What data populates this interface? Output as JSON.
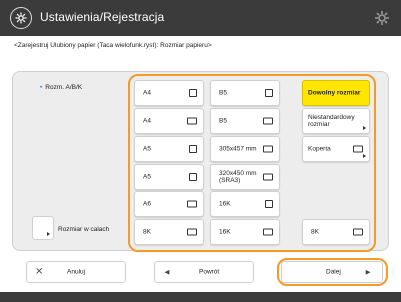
{
  "header": {
    "title": "Ustawienia/Rejestracja",
    "title_icon": "settings-register-icon",
    "right_icon": "gear-icon"
  },
  "breadcrumb": "<Zarejestruj Ulubiony papier (Taca wielofunk.ryst): Rozmiar papieru>",
  "group_label": "Rozm. A/B/K",
  "sizes": [
    {
      "label": "A4",
      "icon": "portrait-page-icon"
    },
    {
      "label": "B5",
      "icon": "portrait-page-icon"
    },
    {
      "label": "A4",
      "icon": "landscape-page-icon"
    },
    {
      "label": "B5",
      "icon": "landscape-page-icon"
    },
    {
      "label": "A5",
      "icon": "portrait-page-icon"
    },
    {
      "label": "305x457 mm",
      "icon": "landscape-page-icon"
    },
    {
      "label": "A5",
      "icon": "portrait-page-icon"
    },
    {
      "label": "320x450 mm (SRA3)",
      "icon": "landscape-page-icon"
    },
    {
      "label": "A6",
      "icon": "landscape-page-icon"
    },
    {
      "label": "16K",
      "icon": "portrait-page-icon"
    },
    {
      "label": "8K",
      "icon": "landscape-page-icon"
    },
    {
      "label": "16K",
      "icon": "landscape-page-icon"
    }
  ],
  "right_options": {
    "any_size": "Dowolny rozmiar",
    "nonstandard": "Niestandardowy rozmiar",
    "envelope": "Koperta",
    "k8": "8K"
  },
  "inches_label": "Rozmiar w calach",
  "footer_buttons": {
    "cancel": "Anuluj",
    "back": "Powrót",
    "next": "Dalej"
  },
  "accent_colors": {
    "selected": "#ffe600",
    "highlight": "#f39a28",
    "titlebar": "#3b3b3b"
  }
}
